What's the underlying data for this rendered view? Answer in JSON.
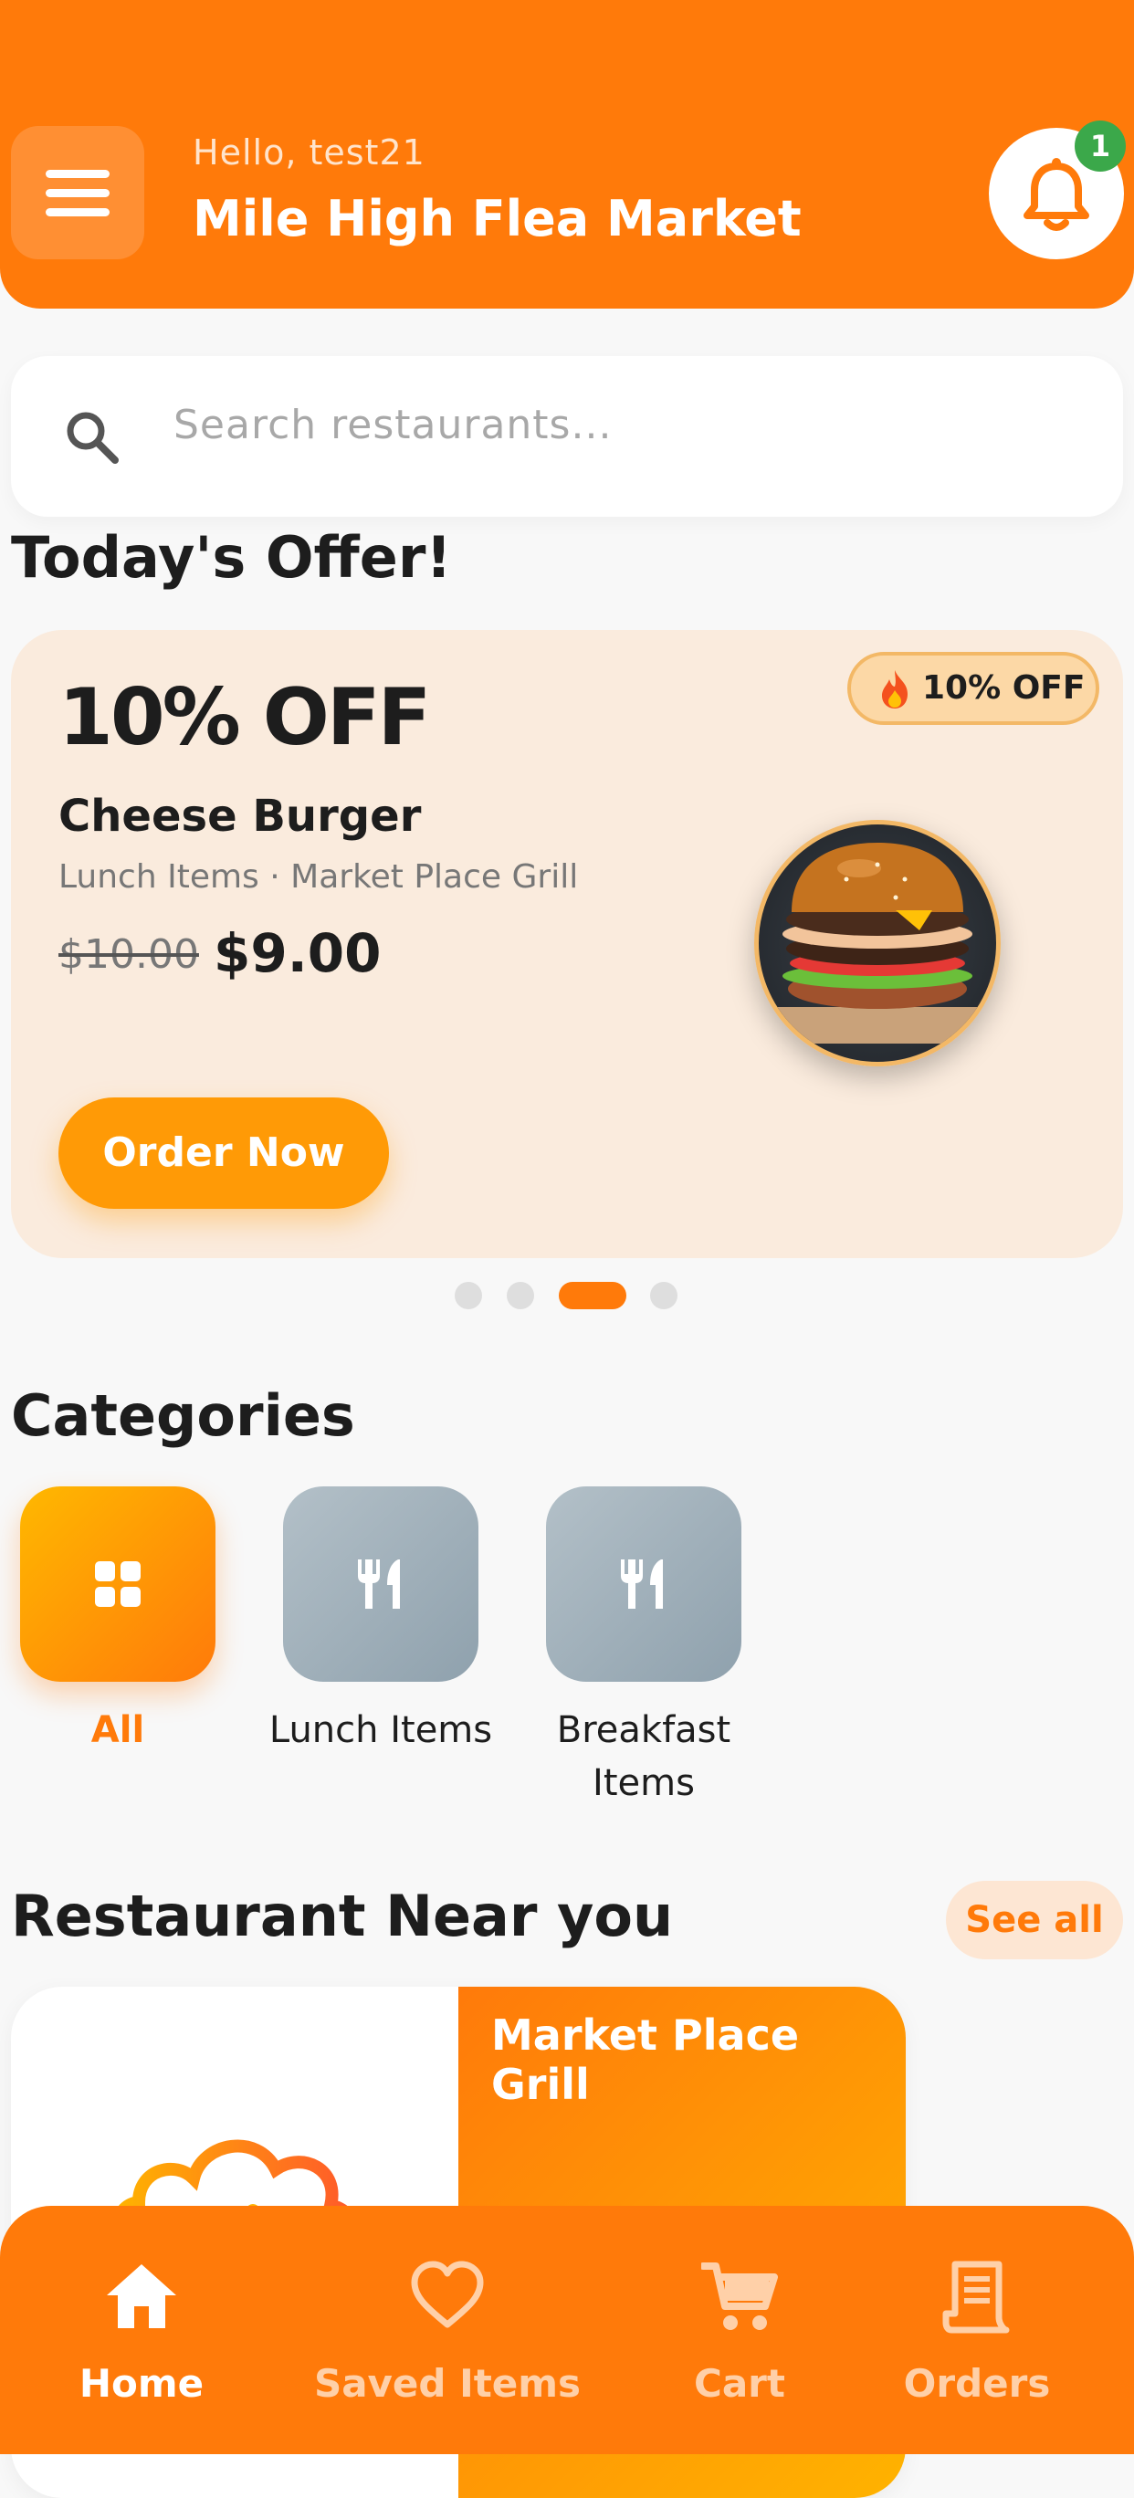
{
  "header": {
    "greeting": "Hello, test21",
    "location": "Mile High Flea Market",
    "notification_count": "1"
  },
  "search": {
    "placeholder": "Search restaurants..."
  },
  "offers": {
    "title": "Today's Offer!",
    "card": {
      "discount": "10% OFF",
      "chip": "10% OFF",
      "chip_icon": "fire-icon",
      "name": "Cheese Burger",
      "subtitle": "Lunch Items · Market Place Grill",
      "old_price": "$10.00",
      "new_price": "$9.00",
      "cta": "Order Now"
    },
    "carousel": {
      "count": 4,
      "active_index": 2
    }
  },
  "categories": {
    "title": "Categories",
    "items": [
      {
        "label": "All",
        "icon": "grid-icon",
        "selected": true
      },
      {
        "label": "Lunch Items",
        "icon": "fork-knife-icon",
        "selected": false
      },
      {
        "label": "Breakfast Items",
        "icon": "fork-knife-icon",
        "selected": false
      }
    ]
  },
  "restaurants": {
    "title": "Restaurant Near you",
    "see_all": "See all",
    "items": [
      {
        "name": "Market Place Grill"
      }
    ]
  },
  "nav": {
    "items": [
      {
        "label": "Home",
        "icon": "home-icon",
        "active": true
      },
      {
        "label": "Saved Items",
        "icon": "heart-icon",
        "active": false
      },
      {
        "label": "Cart",
        "icon": "cart-icon",
        "active": false
      },
      {
        "label": "Orders",
        "icon": "receipt-icon",
        "active": false
      }
    ]
  },
  "colors": {
    "brand": "#ff7a0a",
    "accent": "#ff9a06",
    "badge": "#3ba84a",
    "category_inactive": "#98a8b2"
  }
}
